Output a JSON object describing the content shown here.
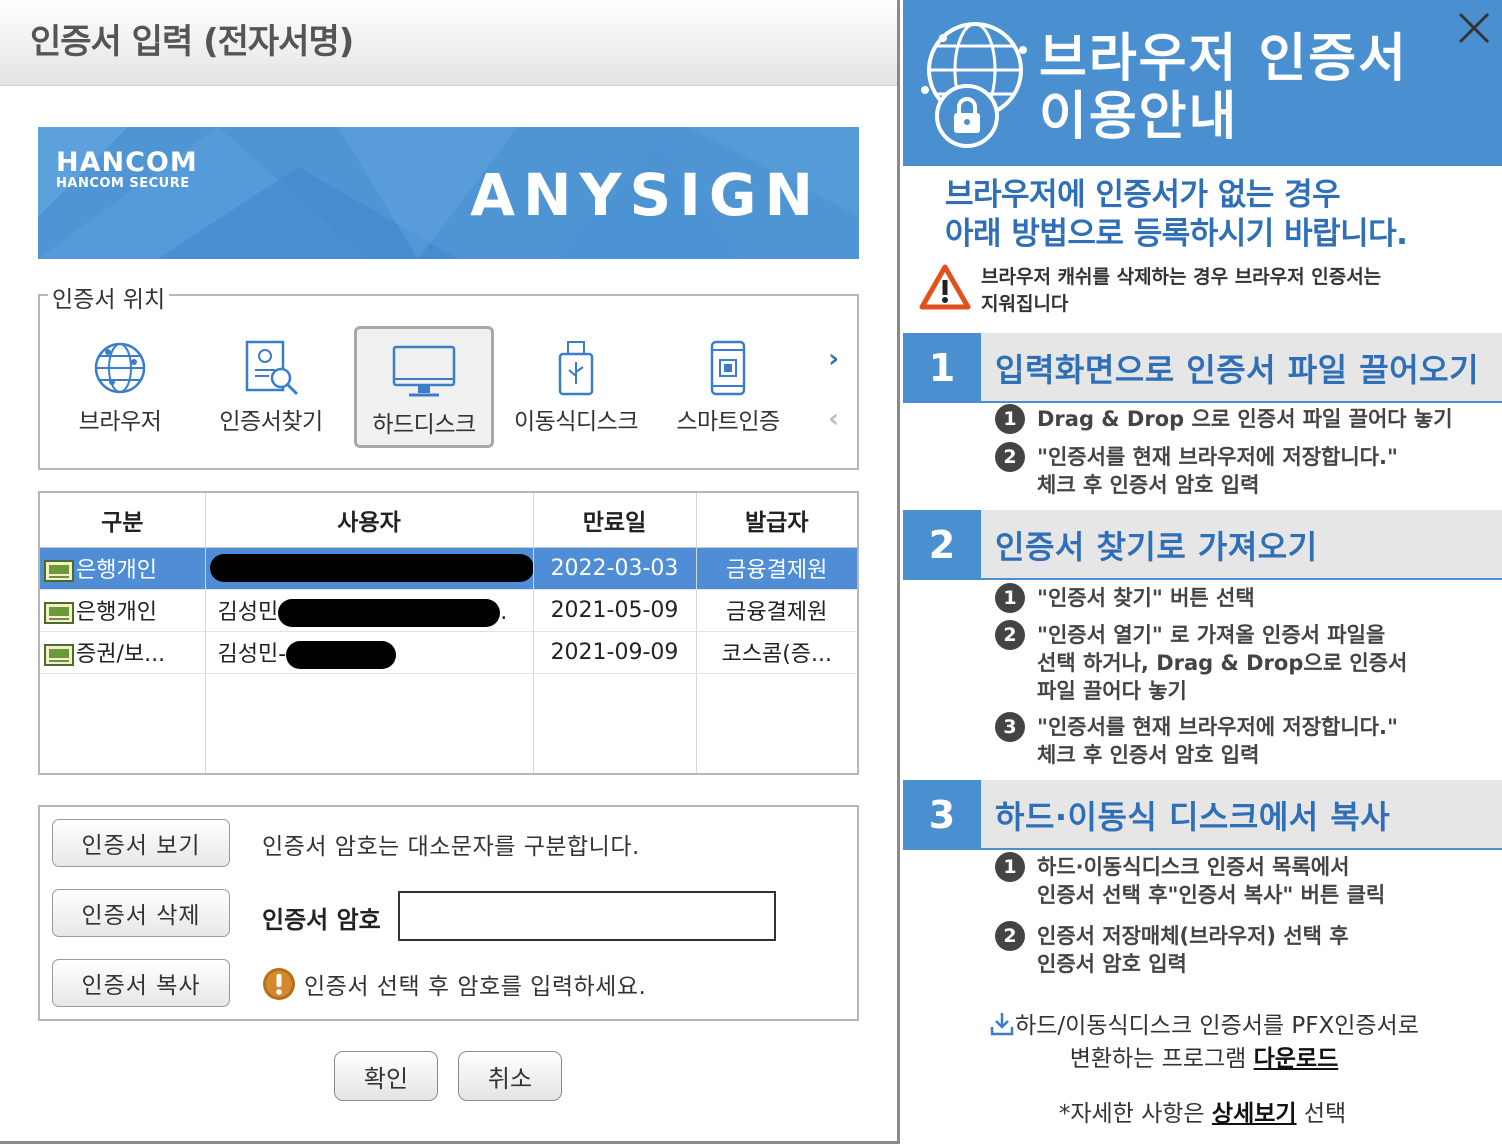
{
  "dialog": {
    "title": "인증서 입력 (전자서명)",
    "banner": {
      "brand": "HANCOM",
      "brand_sub": "HANCOM SECURE",
      "product": "ANYSIGN"
    },
    "location": {
      "legend": "인증서 위치",
      "items": [
        {
          "label": "브라우저",
          "icon": "globe-icon",
          "selected": false
        },
        {
          "label": "인증서찾기",
          "icon": "certificate-search-icon",
          "selected": false
        },
        {
          "label": "하드디스크",
          "icon": "monitor-icon",
          "selected": true
        },
        {
          "label": "이동식디스크",
          "icon": "usb-drive-icon",
          "selected": false
        },
        {
          "label": "스마트인증",
          "icon": "smartphone-icon",
          "selected": false
        }
      ],
      "next": "›",
      "prev": "‹"
    },
    "table": {
      "headers": [
        "구분",
        "사용자",
        "만료일",
        "발급자"
      ],
      "rows": [
        {
          "type": "은행개인",
          "user": "",
          "expiry": "2022-03-03",
          "issuer": "금융결제원",
          "selected": true
        },
        {
          "type": "은행개인",
          "user": "김성민",
          "user_suffix": ".",
          "expiry": "2021-05-09",
          "issuer": "금융결제원",
          "selected": false
        },
        {
          "type": "증권/보...",
          "user": "김성민-",
          "expiry": "2021-09-09",
          "issuer": "코스콤(증...",
          "selected": false
        }
      ]
    },
    "actions": {
      "view": "인증서 보기",
      "delete": "인증서 삭제",
      "copy": "인증서 복사",
      "password_hint": "인증서 암호는 대소문자를 구분합니다.",
      "password_label": "인증서 암호",
      "password_value": "",
      "warning": "인증서 선택 후 암호를 입력하세요."
    },
    "confirm": "확인",
    "cancel": "취소"
  },
  "guide": {
    "title_line1": "브라우저 인증서",
    "title_line2": "이용안내",
    "subtitle_line1": "브라우저에 인증서가 없는 경우",
    "subtitle_line2": "아래 방법으로 등록하시기 바랍니다.",
    "caution_line1": "브라우저 캐쉬를 삭제하는 경우 브라우저 인증서는",
    "caution_line2": "지워집니다",
    "steps": [
      {
        "num": "1",
        "title": "입력화면으로 인증서 파일 끌어오기",
        "items": [
          {
            "n": "1",
            "lines": [
              "Drag & Drop 으로 인증서 파일 끌어다 놓기"
            ]
          },
          {
            "n": "2",
            "lines": [
              "\"인증서를 현재 브라우저에 저장합니다.\"",
              "체크 후 인증서 암호 입력"
            ]
          }
        ]
      },
      {
        "num": "2",
        "title": "인증서 찾기로 가져오기",
        "items": [
          {
            "n": "1",
            "lines": [
              "\"인증서 찾기\" 버튼 선택"
            ]
          },
          {
            "n": "2",
            "lines": [
              "\"인증서 열기\" 로 가져올 인증서 파일을",
              "선택 하거나, Drag & Drop으로 인증서",
              "파일 끌어다 놓기"
            ]
          },
          {
            "n": "3",
            "lines": [
              "\"인증서를 현재 브라우저에 저장합니다.\"",
              "체크 후 인증서 암호 입력"
            ]
          }
        ]
      },
      {
        "num": "3",
        "title": "하드·이동식 디스크에서 복사",
        "items": [
          {
            "n": "1",
            "lines": [
              "하드·이동식디스크 인증서 목록에서",
              "인증서 선택 후\"인증서 복사\" 버튼 클릭"
            ]
          },
          {
            "n": "2",
            "lines": [
              "인증서 저장매체(브라우저) 선택 후",
              "인증서 암호 입력"
            ]
          }
        ]
      }
    ],
    "download_line1": "하드/이동식디스크 인증서를 PFX인증서로",
    "download_line2_pre": "변환하는 프로그램 ",
    "download_link": "다운로드",
    "detail_pre": "*자세한 사항은 ",
    "detail_link": "상세보기",
    "detail_post": " 선택"
  },
  "colors": {
    "accent": "#4a8fd0",
    "accent_text": "#2e6fb7",
    "selected_row": "#4f8ed6"
  }
}
